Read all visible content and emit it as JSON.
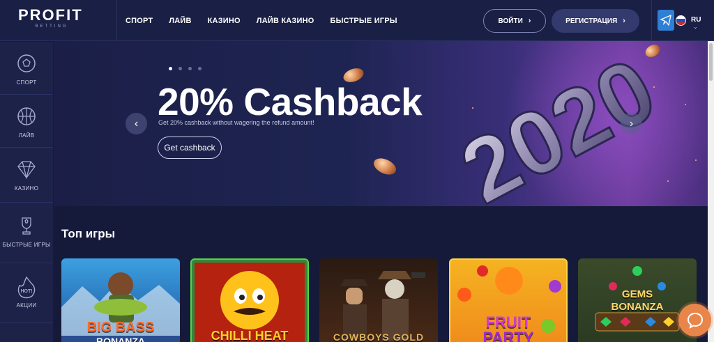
{
  "brand": {
    "logo_main": "PROFIT",
    "logo_sub": "BETTING"
  },
  "nav": {
    "items": [
      {
        "label": "СПОРТ"
      },
      {
        "label": "ЛАЙВ"
      },
      {
        "label": "КАЗИНО"
      },
      {
        "label": "ЛАЙВ КАЗИНО"
      },
      {
        "label": "БЫСТРЫЕ ИГРЫ"
      }
    ]
  },
  "auth": {
    "login_label": "ВОЙТИ",
    "register_label": "РЕГИСТРАЦИЯ"
  },
  "lang": {
    "code": "RU"
  },
  "sidebar": {
    "items": [
      {
        "label": "СПОРТ",
        "icon": "soccer-ball-icon"
      },
      {
        "label": "ЛАЙВ",
        "icon": "basketball-icon"
      },
      {
        "label": "КАЗИНО",
        "icon": "diamond-icon"
      },
      {
        "label": "БЫСТРЫЕ ИГРЫ",
        "icon": "trophy-icon"
      },
      {
        "label": "АКЦИИ",
        "icon": "hot-flame-icon",
        "badge": "HOT!"
      }
    ]
  },
  "banner": {
    "title": "20% Cashback",
    "subtitle": "Get 20% cashback without wagering the refund amount!",
    "cta": "Get cashback",
    "year": "2020",
    "slides": 4,
    "active_slide": 1
  },
  "games": {
    "title": "Топ игры",
    "items": [
      {
        "name": "BIG BASS",
        "sub": "BONANZA"
      },
      {
        "name": "CHILLI HEAT",
        "sub": ""
      },
      {
        "name": "COWBOYS GOLD",
        "sub": ""
      },
      {
        "name": "FRUIT",
        "sub": "PARTY"
      },
      {
        "name": "GEMS",
        "sub": "BONANZA"
      }
    ]
  },
  "colors": {
    "accent": "#e8854a",
    "header_bg": "#1a1f45",
    "page_bg": "#161a3a"
  }
}
